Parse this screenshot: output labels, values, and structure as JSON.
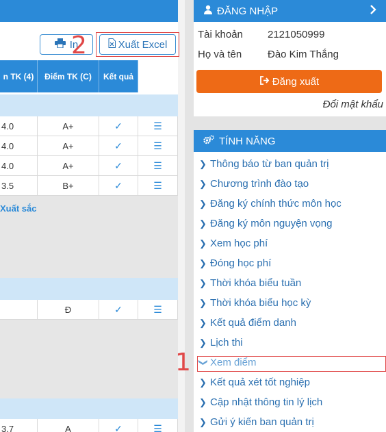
{
  "toolbar": {
    "print_label": "In",
    "excel_label": "Xuất Excel"
  },
  "annotations": {
    "marker_1": "1",
    "marker_2": "2"
  },
  "table": {
    "headers": [
      "n TK (4)",
      "Điểm TK (C)",
      "Kết quả",
      ""
    ],
    "rows": [
      {
        "tk4": "4.0",
        "tkc": "A+",
        "check": "✓",
        "detail": "☰"
      },
      {
        "tk4": "4.0",
        "tkc": "A+",
        "check": "✓",
        "detail": "☰"
      },
      {
        "tk4": "4.0",
        "tkc": "A+",
        "check": "✓",
        "detail": "☰"
      },
      {
        "tk4": "3.5",
        "tkc": "B+",
        "check": "✓",
        "detail": "☰"
      }
    ],
    "classification": "Xuất sắc",
    "row_d": {
      "tk4": "",
      "tkc": "Đ",
      "check": "✓",
      "detail": "☰"
    },
    "row_last": {
      "tk4": "3.7",
      "tkc": "A",
      "check": "✓",
      "detail": "☰"
    }
  },
  "login_panel": {
    "title": "ĐĂNG NHẬP",
    "account_label": "Tài khoản",
    "account_value": "2121050999",
    "name_label": "Họ và tên",
    "name_value": "Đào Kim Thắng",
    "logout_label": "Đăng xuất",
    "change_password": "Đổi mật khẩu"
  },
  "features_panel": {
    "title": "TÍNH NĂNG",
    "items": [
      "Thông báo từ ban quản trị",
      "Chương trình đào tạo",
      "Đăng ký chính thức môn học",
      "Đăng ký môn nguyện vọng",
      "Xem học phí",
      "Đóng học phí",
      "Thời khóa biểu tuần",
      "Thời khóa biểu học kỳ",
      "Kết quả điểm danh",
      "Lịch thi",
      "Xem điểm",
      "Kết quả xét tốt nghiệp",
      "Cập nhật thông tin lý lịch",
      "Gửi ý kiến ban quản trị"
    ]
  },
  "colors": {
    "primary": "#2b8ad8",
    "accent": "#ee6a16",
    "annotation": "#e04848"
  },
  "icons": {
    "user": "user-icon",
    "gears": "gears-icon",
    "chevron": "chevron-right-icon",
    "printer": "printer-icon",
    "excel": "excel-file-icon",
    "logout": "sign-out-icon"
  }
}
